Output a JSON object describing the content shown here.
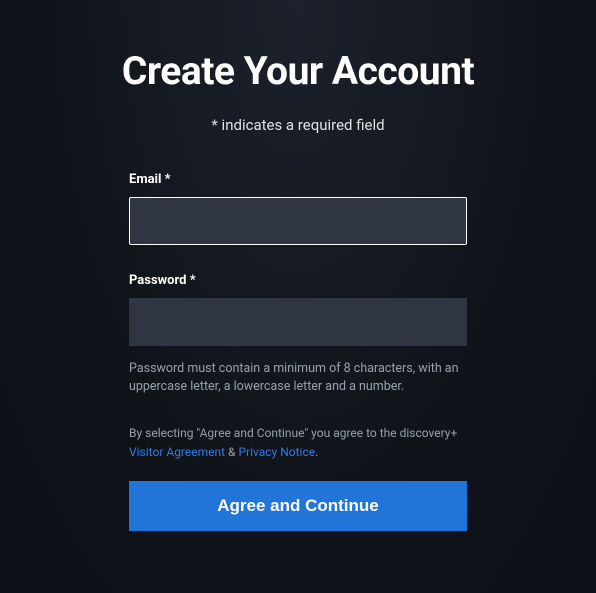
{
  "title": "Create Your Account",
  "subtitle": "* indicates a required field",
  "form": {
    "email": {
      "label": "Email *",
      "value": ""
    },
    "password": {
      "label": "Password *",
      "value": "",
      "hint": "Password must contain a minimum of 8 characters, with an uppercase letter, a lowercase letter and a number."
    },
    "legal": {
      "prefix": "By selecting \"Agree and Continue\" you agree to the discovery+ ",
      "visitor_agreement": "Visitor Agreement",
      "ampersand": " & ",
      "privacy_notice": "Privacy Notice",
      "suffix": "."
    },
    "submit_label": "Agree and Continue"
  }
}
